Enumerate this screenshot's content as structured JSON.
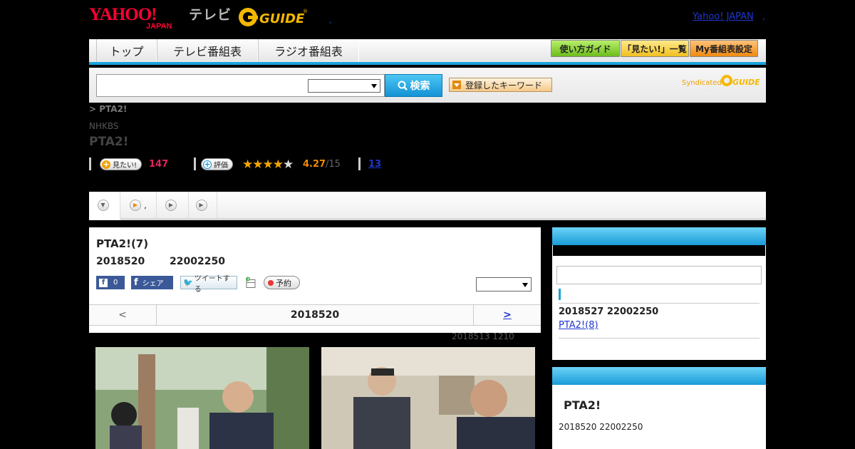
{
  "header": {
    "logo_text": "YAHOO! JAPAN",
    "tv_label": "テレビ",
    "gguide_text": "G GUIDE",
    "dot": ",",
    "yahoo_link": "Yahoo! JAPAN",
    "yahoo_link_dot": ","
  },
  "nav": {
    "tabs": [
      "トップ",
      "テレビ番組表",
      "ラジオ番組表"
    ],
    "buttons": [
      "使い方ガイド",
      "「見たい!」一覧",
      "My番組表設定"
    ]
  },
  "search": {
    "button_label": "検索",
    "keyword_button": "登録したキーワード",
    "syndicated": "Syndicated",
    "syndicated_logo": "GUIDE"
  },
  "breadcrumb": "> PTA2!",
  "channel": "NHKBS",
  "program_title": "PTA2!",
  "stats": {
    "want_label": "見たい!",
    "want_count": "147",
    "rate_label": "評価",
    "rating": "4.27",
    "rating_of": "/15",
    "review_count": "13",
    "stars_filled": 4.27,
    "stars_total": 5
  },
  "tabs": [
    "",
    ",",
    "",
    ""
  ],
  "episode": {
    "title": "PTA2!(7)",
    "date": "2018520",
    "time": "22002250",
    "like_count": "0",
    "share_label": "シェア",
    "tweet_label": "ツイートする",
    "reserve_label": "予約",
    "nav_prev": "<",
    "nav_date": "2018520",
    "nav_next": ">",
    "updated": "2018513  1210"
  },
  "sidebar": {
    "next_date": "2018527  22002250",
    "next_link": "PTA2!(8)",
    "box2_title": "PTA2!",
    "box2_date": "2018520  22002250"
  },
  "colors": {
    "accent_blue": "#19a3dc",
    "want_pink": "#e0245e",
    "rating_orange": "#f08a00",
    "link_blue": "#1f36d1"
  }
}
